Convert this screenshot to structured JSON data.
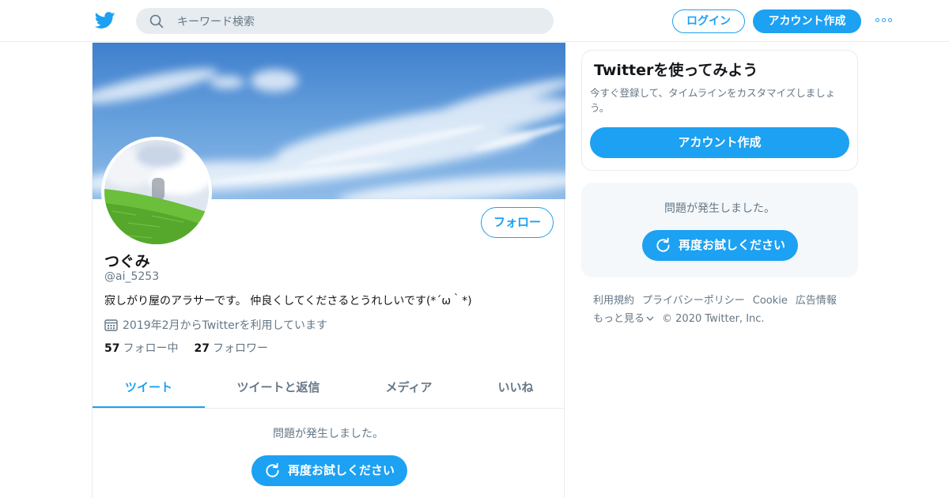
{
  "header": {
    "search_placeholder": "キーワード検索",
    "login_label": "ログイン",
    "signup_label": "アカウント作成"
  },
  "profile": {
    "display_name": "つぐみ",
    "handle": "@ai_5253",
    "bio": "寂しがり屋のアラサーです。 仲良くしてくださるとうれしいです(*´ω｀*)",
    "joined": "2019年2月からTwitterを利用しています",
    "follow_label": "フォロー",
    "following_count": "57",
    "following_label": "フォロー中",
    "followers_count": "27",
    "followers_label": "フォロワー"
  },
  "tabs": [
    {
      "label": "ツイート",
      "active": true
    },
    {
      "label": "ツイートと返信",
      "active": false
    },
    {
      "label": "メディア",
      "active": false
    },
    {
      "label": "いいね",
      "active": false
    }
  ],
  "timeline": {
    "error_text": "問題が発生しました。",
    "retry_label": "再度お試しください"
  },
  "signup_card": {
    "title": "Twitterを使ってみよう",
    "description": "今すぐ登録して、タイムラインをカスタマイズしましょう。",
    "button_label": "アカウント作成"
  },
  "sidebar_error": {
    "error_text": "問題が発生しました。",
    "retry_label": "再度お試しください"
  },
  "footer": {
    "links": [
      "利用規約",
      "プライバシーポリシー",
      "Cookie",
      "広告情報"
    ],
    "more_label": "もっと見る",
    "copyright": "© 2020 Twitter, Inc."
  },
  "colors": {
    "accent": "#1da1f2",
    "secondary_text": "#657786",
    "border": "#e6ecf0",
    "panel_bg": "#f5f8fa"
  },
  "icons": [
    "twitter-bird-icon",
    "search-icon",
    "more-dots-icon",
    "calendar-icon",
    "refresh-icon",
    "chevron-down-icon"
  ]
}
